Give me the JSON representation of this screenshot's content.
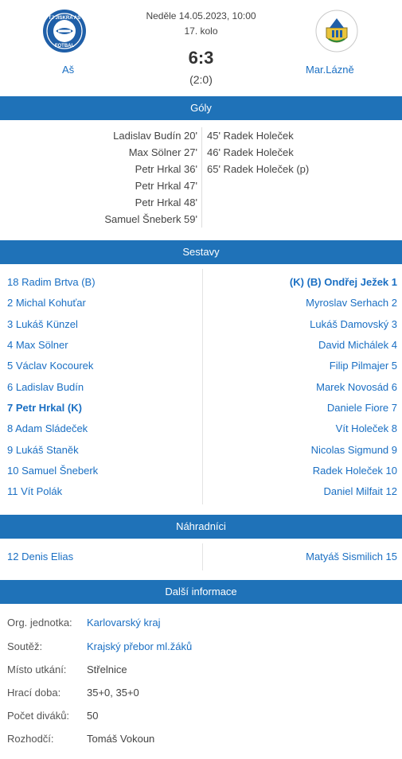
{
  "match": {
    "date": "Neděle 14.05.2023, 10:00",
    "round": "17. kolo",
    "score": "6:3",
    "halftime": "(2:0)",
    "home_team": "Aš",
    "away_team": "Mar.Lázně"
  },
  "home_logo": {
    "text_top": "TJ JISKRA AŠ",
    "text_bottom": "FOTBAL"
  },
  "sections": {
    "goals": "Góly",
    "lineups": "Sestavy",
    "subs": "Náhradníci",
    "info": "Další informace"
  },
  "goals": {
    "home": [
      "Ladislav Budín 20'",
      "Max Sölner 27'",
      "Petr Hrkal 36'",
      "Petr Hrkal 47'",
      "Petr Hrkal 48'",
      "Samuel Šneberk 59'"
    ],
    "away": [
      "45' Radek Holeček",
      "46' Radek Holeček",
      "65' Radek Holeček (p)"
    ]
  },
  "lineups": {
    "home": [
      "18 Radim Brtva (B)",
      "2 Michal Kohuťar",
      "3 Lukáš Künzel",
      "4 Max Sölner",
      "5 Václav Kocourek",
      "6 Ladislav Budín",
      "7 Petr Hrkal (K)",
      "8 Adam Sládeček",
      "9 Lukáš Staněk",
      "10 Samuel Šneberk",
      "11 Vít Polák"
    ],
    "away": [
      "(K) (B) Ondřej Ježek 1",
      "Myroslav Serhach 2",
      "Lukáš Damovský 3",
      "David Michálek 4",
      "Filip Pilmajer 5",
      "Marek Novosád 6",
      "Daniele Fiore 7",
      "Vít Holeček 8",
      "Nicolas Sigmund 9",
      "Radek Holeček 10",
      "Daniel Milfait 12"
    ]
  },
  "subs": {
    "home": [
      "12 Denis Elias"
    ],
    "away": [
      "Matyáš Sismilich 15"
    ]
  },
  "info": [
    {
      "label": "Org. jednotka:",
      "value": "Karlovarský kraj"
    },
    {
      "label": "Soutěž:",
      "value": "Krajský přebor ml.žáků"
    },
    {
      "label": "Místo utkání:",
      "value": "Střelnice"
    },
    {
      "label": "Hrací doba:",
      "value": "35+0, 35+0"
    },
    {
      "label": "Počet diváků:",
      "value": "50"
    },
    {
      "label": "Rozhodčí:",
      "value": "Tomáš Vokoun"
    }
  ],
  "colors": {
    "section_bar": "#1f72b8",
    "link": "#1a6fc3",
    "text": "#444444"
  }
}
